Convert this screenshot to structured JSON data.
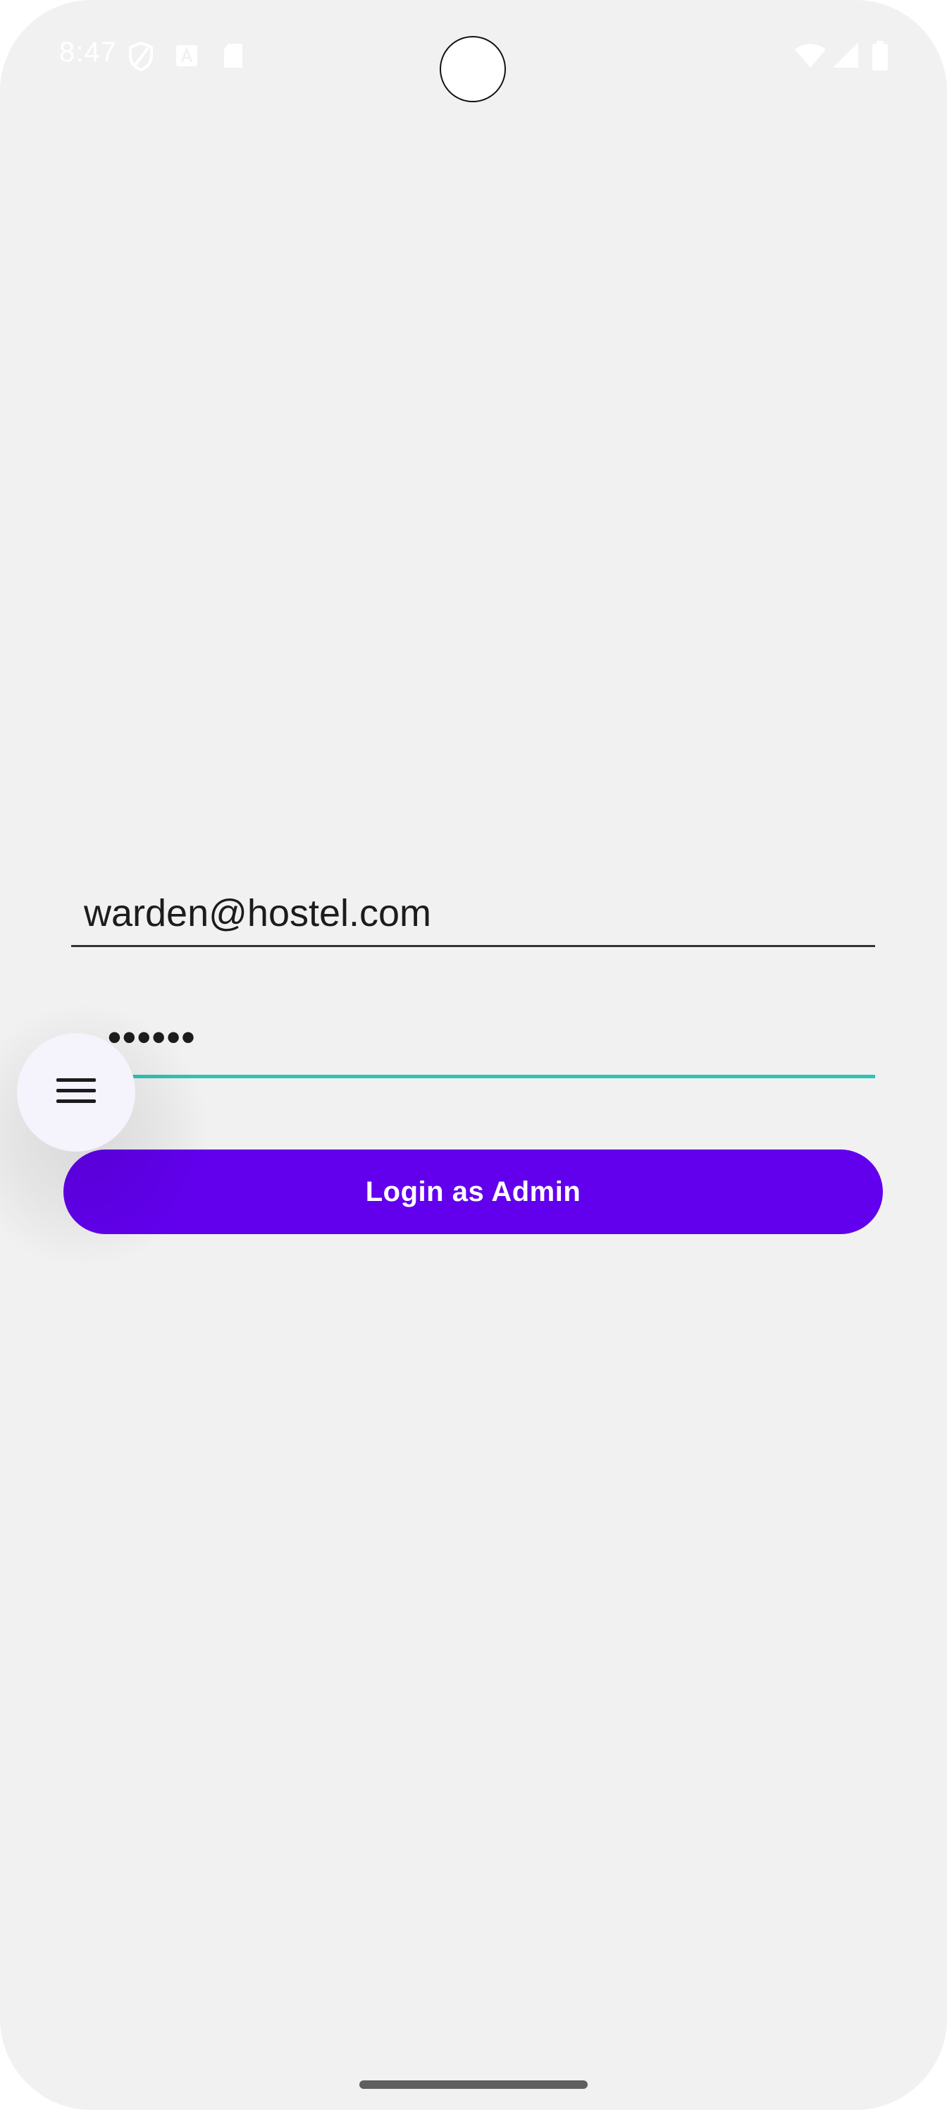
{
  "status_bar": {
    "time": "8:47",
    "left_icons": [
      "shield-icon",
      "text-a-icon",
      "sd-card-icon"
    ],
    "right_icons": [
      "wifi-icon",
      "signal-icon",
      "battery-icon"
    ]
  },
  "login_form": {
    "email_value": "warden@hostel.com",
    "password_value": "••••••",
    "submit_label": "Login as Admin"
  },
  "floating_menu": {
    "icon": "hamburger-menu-icon"
  },
  "colors": {
    "background": "#f1f1f1",
    "primary_button": "#6200ee",
    "focus_underline": "#2ec4b6"
  }
}
